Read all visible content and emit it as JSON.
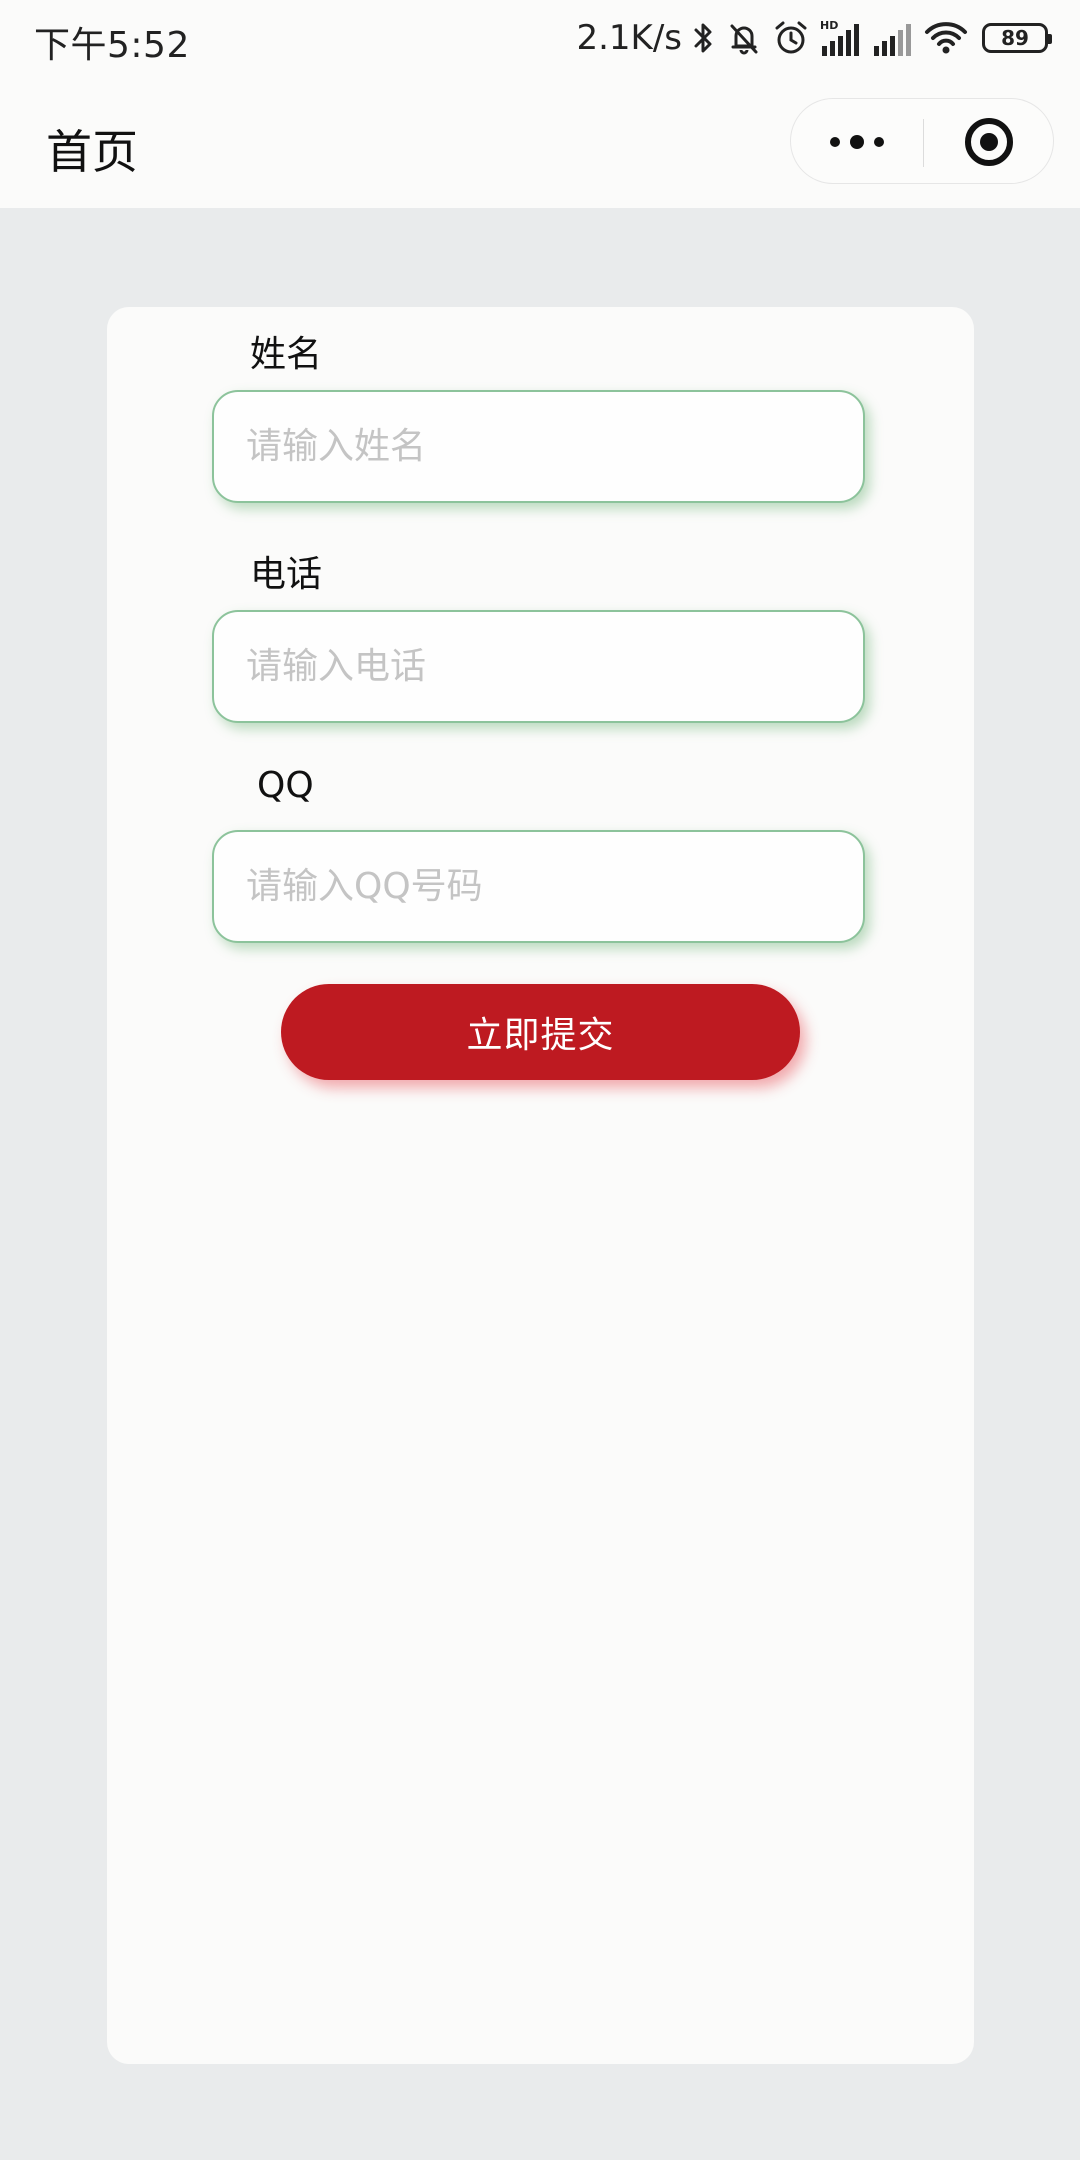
{
  "status_bar": {
    "time": "下午5:52",
    "net_speed": "2.1K/s",
    "battery": "89",
    "icons": [
      "bluetooth-icon",
      "mute-bell-icon",
      "alarm-icon",
      "hd-signal-icon",
      "signal-icon",
      "wifi-icon",
      "battery-icon"
    ]
  },
  "nav": {
    "title": "首页",
    "more_icon": "more-dots-icon",
    "close_icon": "target-circle-icon"
  },
  "form": {
    "fields": [
      {
        "label": "姓名",
        "placeholder": "请输入姓名",
        "value": ""
      },
      {
        "label": "电话",
        "placeholder": "请输入电话",
        "value": ""
      },
      {
        "label": "QQ",
        "placeholder": "请输入QQ号码",
        "value": ""
      }
    ],
    "submit_label": "立即提交"
  },
  "colors": {
    "accent": "#be1a21",
    "input_border": "#8cc39b",
    "page_bg": "#e9ebec",
    "card_bg": "#fbfbfa"
  }
}
